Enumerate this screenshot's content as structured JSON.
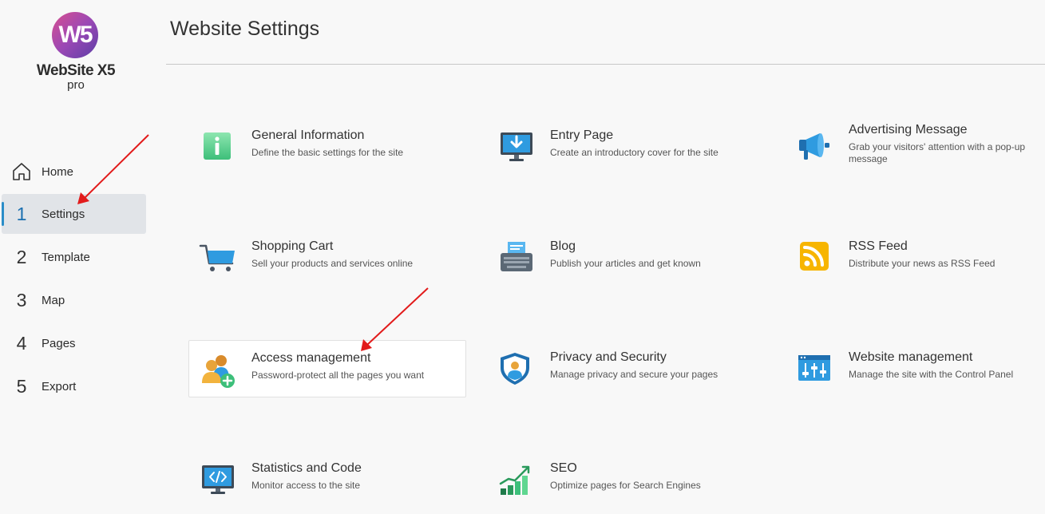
{
  "brand": {
    "logo_mark": "W5",
    "name": "WebSite X5",
    "edition": "pro"
  },
  "sidebar": {
    "items": [
      {
        "num": "",
        "icon": "home-icon",
        "label": "Home"
      },
      {
        "num": "1",
        "label": "Settings",
        "active": true
      },
      {
        "num": "2",
        "label": "Template"
      },
      {
        "num": "3",
        "label": "Map"
      },
      {
        "num": "4",
        "label": "Pages"
      },
      {
        "num": "5",
        "label": "Export"
      }
    ]
  },
  "header": {
    "title": "Website Settings"
  },
  "cards": [
    {
      "title": "General Information",
      "desc": "Define the basic settings for the site",
      "icon": "info-icon"
    },
    {
      "title": "Entry Page",
      "desc": "Create an introductory cover for the site",
      "icon": "monitor-download-icon"
    },
    {
      "title": "Advertising Message",
      "desc": "Grab your visitors' attention with a pop-up message",
      "icon": "megaphone-icon"
    },
    {
      "title": "Shopping Cart",
      "desc": "Sell your products and services online",
      "icon": "cart-icon"
    },
    {
      "title": "Blog",
      "desc": "Publish your articles and get known",
      "icon": "typewriter-icon"
    },
    {
      "title": "RSS Feed",
      "desc": "Distribute your news as RSS Feed",
      "icon": "rss-icon"
    },
    {
      "title": "Access management",
      "desc": "Password-protect all the pages you want",
      "icon": "users-add-icon"
    },
    {
      "title": "Privacy and Security",
      "desc": "Manage privacy and secure your pages",
      "icon": "shield-user-icon"
    },
    {
      "title": "Website management",
      "desc": "Manage the site with the Control Panel",
      "icon": "control-panel-icon"
    },
    {
      "title": "Statistics and Code",
      "desc": "Monitor access to the site",
      "icon": "code-monitor-icon"
    },
    {
      "title": "SEO",
      "desc": "Optimize pages for Search Engines",
      "icon": "growth-chart-icon"
    }
  ],
  "colors": {
    "accent": "#2a8dc8",
    "annotation_arrow": "#e21b1b"
  }
}
